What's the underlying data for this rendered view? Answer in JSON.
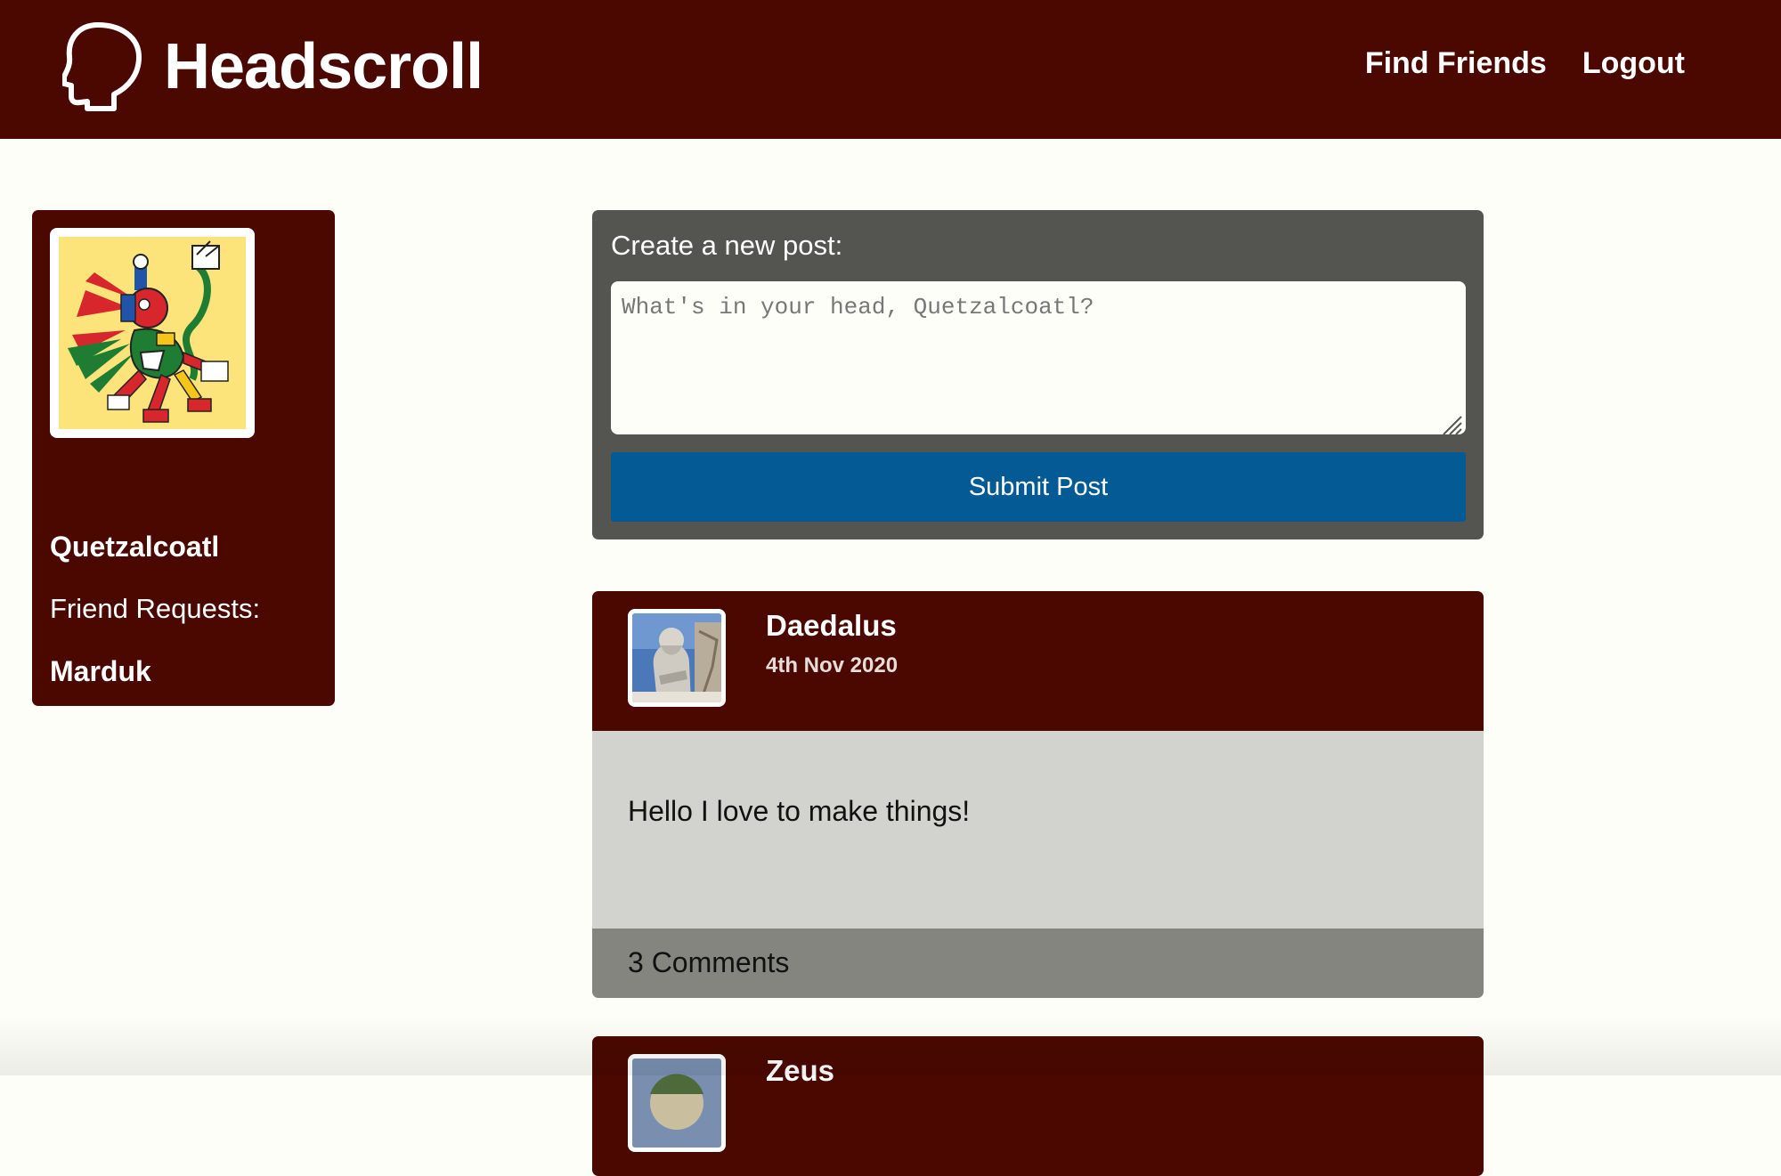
{
  "header": {
    "brand_title": "Headscroll",
    "nav": {
      "find_friends": "Find Friends",
      "logout": "Logout"
    }
  },
  "profile": {
    "name": "Quetzalcoatl",
    "friend_requests_label": "Friend Requests:",
    "friend_requests": [
      "Marduk"
    ]
  },
  "composer": {
    "label": "Create a new post:",
    "placeholder": "What's in your head, Quetzalcoatl?",
    "submit_label": "Submit Post"
  },
  "posts": [
    {
      "author": "Daedalus",
      "date": "4th Nov 2020",
      "text": "Hello I love to make things!",
      "comments": "3 Comments"
    },
    {
      "author": "Zeus"
    }
  ],
  "colors": {
    "header_bg": "#4a0800",
    "page_bg": "#fefef9",
    "composer_bg": "#545450",
    "button_bg": "#035a94",
    "post_body_bg": "#d2d2ce",
    "post_footer_bg": "#858580",
    "avatar_bg": "#fde47a"
  }
}
